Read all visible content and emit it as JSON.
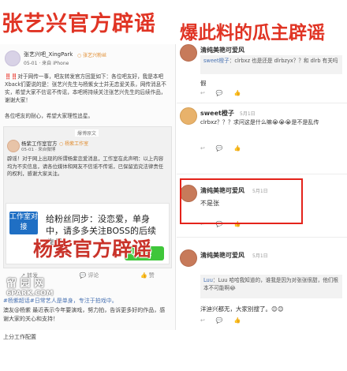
{
  "headlines": {
    "left": "张艺兴官方辟谣",
    "right": "爆此料的瓜主辟谣",
    "bottom": "杨紫官方辟谣"
  },
  "left_post": {
    "author": "张艺兴吧_XingPark",
    "author_suffix": "○ 张艺兴粉丝",
    "time": "05-01 · 来自 iPhone",
    "body": "‼️‼️对于网传一事，吧友转发官方回复如下：各位吧友好，我是本吧Xback们要说的是：张艺兴先生与杨紫女士并无恋爱关系，网传消息不实，希望大家不信谣不传谣，本吧将持续关注张艺兴先生的后续作品，谢谢大家！",
    "body_tail": "各位吧友的耐心，希望大家理性追星。",
    "forward_label": "爆博原文",
    "forward_author": "杨紫工作室官方",
    "forward_author_suffix": "○ 杨紫工作室",
    "forward_time": "05-01 · 来自微博",
    "forward_body": "辟谣！对于网上出现的所谓杨紫恋爱消息，工作室在此声明：以上内容均为不实信息，请各位媒体和网友不信谣不传谣，已保留追究法律责任的权利，感谢大家关注。",
    "studio_badge": "工作室对接",
    "inner_message": "给粉丝同步：没恋爱，单身中，请多多关注BOSS的后续作品",
    "got_it": "收到！",
    "actions": {
      "share": "转发",
      "comment": "评论",
      "like": "赞"
    }
  },
  "lower_post": {
    "hashtag": "#杨紫超话#日常艺人是单身，专注于拍戏中。",
    "body": "澳友@杨紫 最近表示今年要演戏，努力拍，告诉更多好的作品，感谢大家的关心和支持！",
    "tail": "上分工作配置"
  },
  "comments": [
    {
      "name": "清纯美艳可爱风",
      "reply_who": "sweet橙子",
      "reply_text": "clrbxz 也是还是 dlrbzyx？？和 dlrb 有关吗",
      "text": "假",
      "time": "",
      "likes": ""
    },
    {
      "name": "sweet橙子",
      "meta": "5月1日",
      "text": "clrbxz？？？求问这是什么嘛😭😭😭是不是乱传",
      "time": "",
      "likes": ""
    },
    {
      "name": "清纯美艳可爱风",
      "meta": "5月1日",
      "text": "不是张",
      "time": "",
      "likes": ""
    },
    {
      "name": "清纯美艳可爱风",
      "meta": "5月1日",
      "reply_who": "Luu",
      "reply_text": "Luu 哈哈我知道的，谁我是因为对张张很甜，他们根本不可能啊😂",
      "text": "洋迪兴都无，大家别搜了。😊😊",
      "time": "",
      "likes": ""
    }
  ],
  "watermark": {
    "line1": "留 园 网",
    "line2": "6PARK.COM"
  }
}
